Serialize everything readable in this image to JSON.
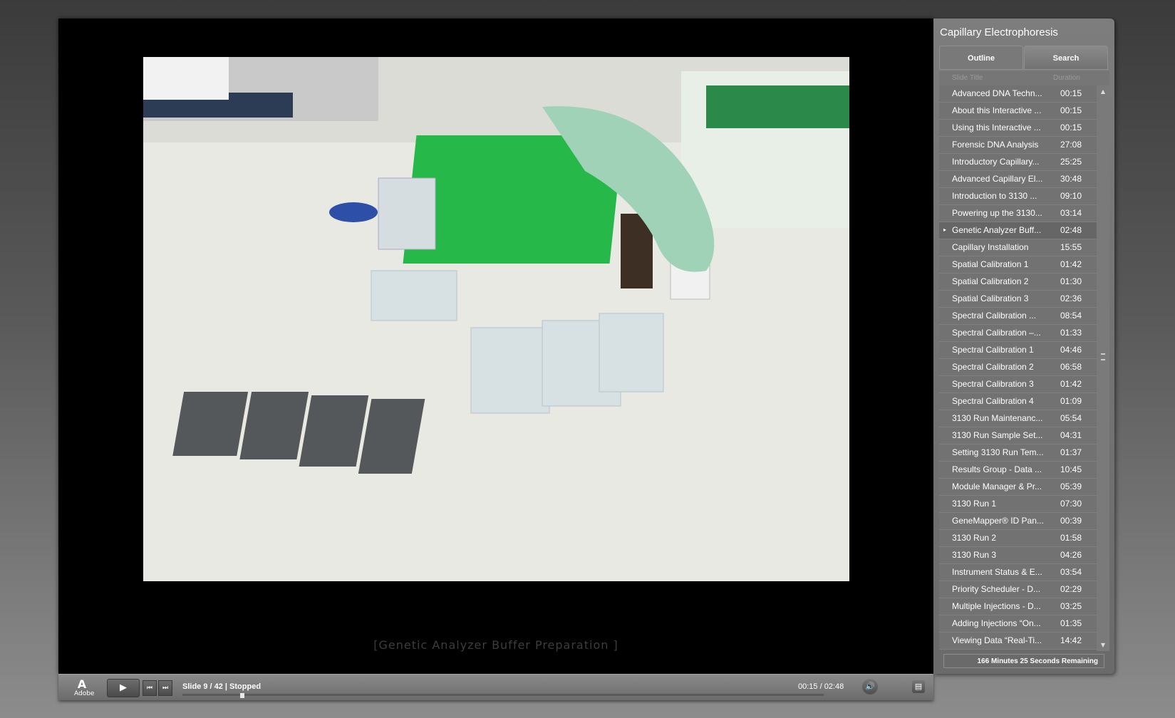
{
  "player": {
    "caption": "[Genetic Analyzer Buffer Preparation ]",
    "adobe_label": "Adobe",
    "status": "Slide 9 / 42 | Stopped",
    "time": "00:15 / 02:48",
    "progress": 0.09,
    "icons": {
      "play": "play-icon",
      "prev": "previous-icon",
      "next": "next-icon",
      "volume": "volume-icon",
      "toggle": "sidebar-toggle-icon"
    }
  },
  "sidebar": {
    "title": "Capillary Electrophoresis",
    "tabs": [
      "Outline",
      "Search"
    ],
    "columns": {
      "title": "Slide Title",
      "duration": "Duration"
    },
    "current_index": 8,
    "items": [
      {
        "title": "Advanced DNA Techn...",
        "duration": "00:15"
      },
      {
        "title": "About this Interactive ...",
        "duration": "00:15"
      },
      {
        "title": "Using this Interactive ...",
        "duration": "00:15"
      },
      {
        "title": "Forensic DNA Analysis",
        "duration": "27:08"
      },
      {
        "title": "Introductory Capillary...",
        "duration": "25:25"
      },
      {
        "title": "Advanced Capillary El...",
        "duration": "30:48"
      },
      {
        "title": "Introduction to 3130 ...",
        "duration": "09:10"
      },
      {
        "title": "Powering up the 3130...",
        "duration": "03:14"
      },
      {
        "title": "Genetic Analyzer Buff...",
        "duration": "02:48"
      },
      {
        "title": "Capillary Installation",
        "duration": "15:55"
      },
      {
        "title": "Spatial Calibration 1",
        "duration": "01:42"
      },
      {
        "title": "Spatial Calibration 2",
        "duration": "01:30"
      },
      {
        "title": "Spatial Calibration 3",
        "duration": "02:36"
      },
      {
        "title": "Spectral Calibration ...",
        "duration": "08:54"
      },
      {
        "title": "Spectral Calibration –...",
        "duration": "01:33"
      },
      {
        "title": "Spectral Calibration 1",
        "duration": "04:46"
      },
      {
        "title": "Spectral Calibration 2",
        "duration": "06:58"
      },
      {
        "title": "Spectral Calibration 3",
        "duration": "01:42"
      },
      {
        "title": "Spectral Calibration 4",
        "duration": "01:09"
      },
      {
        "title": "3130 Run Maintenanc...",
        "duration": "05:54"
      },
      {
        "title": "3130 Run Sample Set...",
        "duration": "04:31"
      },
      {
        "title": "Setting 3130 Run Tem...",
        "duration": "01:37"
      },
      {
        "title": "Results Group - Data ...",
        "duration": "10:45"
      },
      {
        "title": "Module Manager & Pr...",
        "duration": "05:39"
      },
      {
        "title": "3130 Run 1",
        "duration": "07:30"
      },
      {
        "title": "GeneMapper® ID Pan...",
        "duration": "00:39"
      },
      {
        "title": "3130 Run 2",
        "duration": "01:58"
      },
      {
        "title": "3130 Run 3",
        "duration": "04:26"
      },
      {
        "title": "Instrument Status & E...",
        "duration": "03:54"
      },
      {
        "title": "Priority Scheduler - D...",
        "duration": "02:29"
      },
      {
        "title": "Multiple Injections - D...",
        "duration": "03:25"
      },
      {
        "title": "Adding Injections “On...",
        "duration": "01:35"
      },
      {
        "title": "Viewing Data “Real-Ti...",
        "duration": "14:42"
      }
    ],
    "remaining": "166 Minutes 25 Seconds Remaining"
  }
}
